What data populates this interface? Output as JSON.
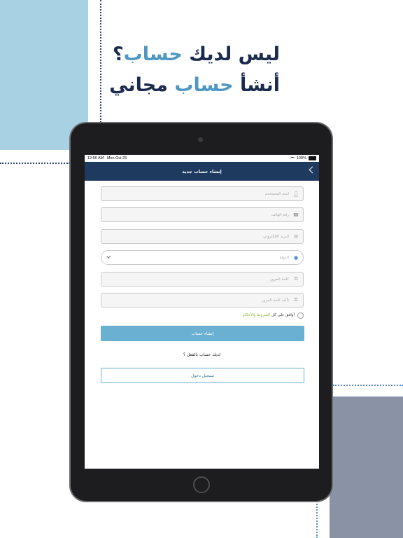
{
  "headline": {
    "line1_part1": "ليس لديك",
    "line1_accent": "حساب",
    "line1_part2": "؟",
    "line2_part1": "أنشأ",
    "line2_accent": "حساب",
    "line2_part2": "مجاني"
  },
  "status_bar": {
    "time": "12:56 AM",
    "date": "Mon Oct 25",
    "battery": "100%"
  },
  "nav": {
    "title": "إنشاء حساب جديد"
  },
  "form": {
    "username_placeholder": "اسم المستخدم",
    "phone_placeholder": "رقم الهاتف",
    "email_placeholder": "البريد الإلكتروني",
    "country_placeholder": "الدولة",
    "password_placeholder": "كلمة المرور",
    "confirm_password_placeholder": "تأكيد كلمة المرور",
    "terms_prefix": "أوافق على كل",
    "terms_link": "الشروط والأحكام",
    "create_button": "إنشاء حساب",
    "have_account": "لديك حساب بالفعل ؟",
    "login_button": "تسجيل دخول"
  },
  "colors": {
    "navbar": "#1f3a5f",
    "accent": "#4e97c4",
    "button": "#6ab0d2",
    "terms_link": "#8cb82e"
  }
}
